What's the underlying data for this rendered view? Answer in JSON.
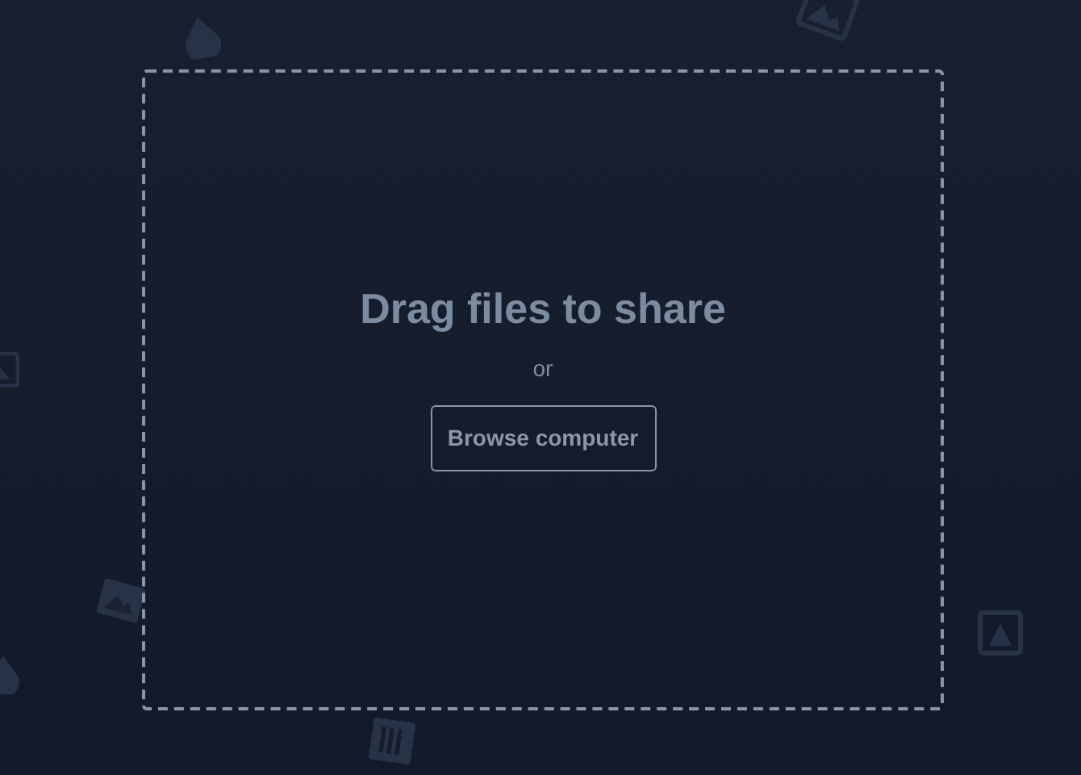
{
  "dropzone": {
    "title": "Drag files to share",
    "separator": "or",
    "button": "Browse computer"
  }
}
